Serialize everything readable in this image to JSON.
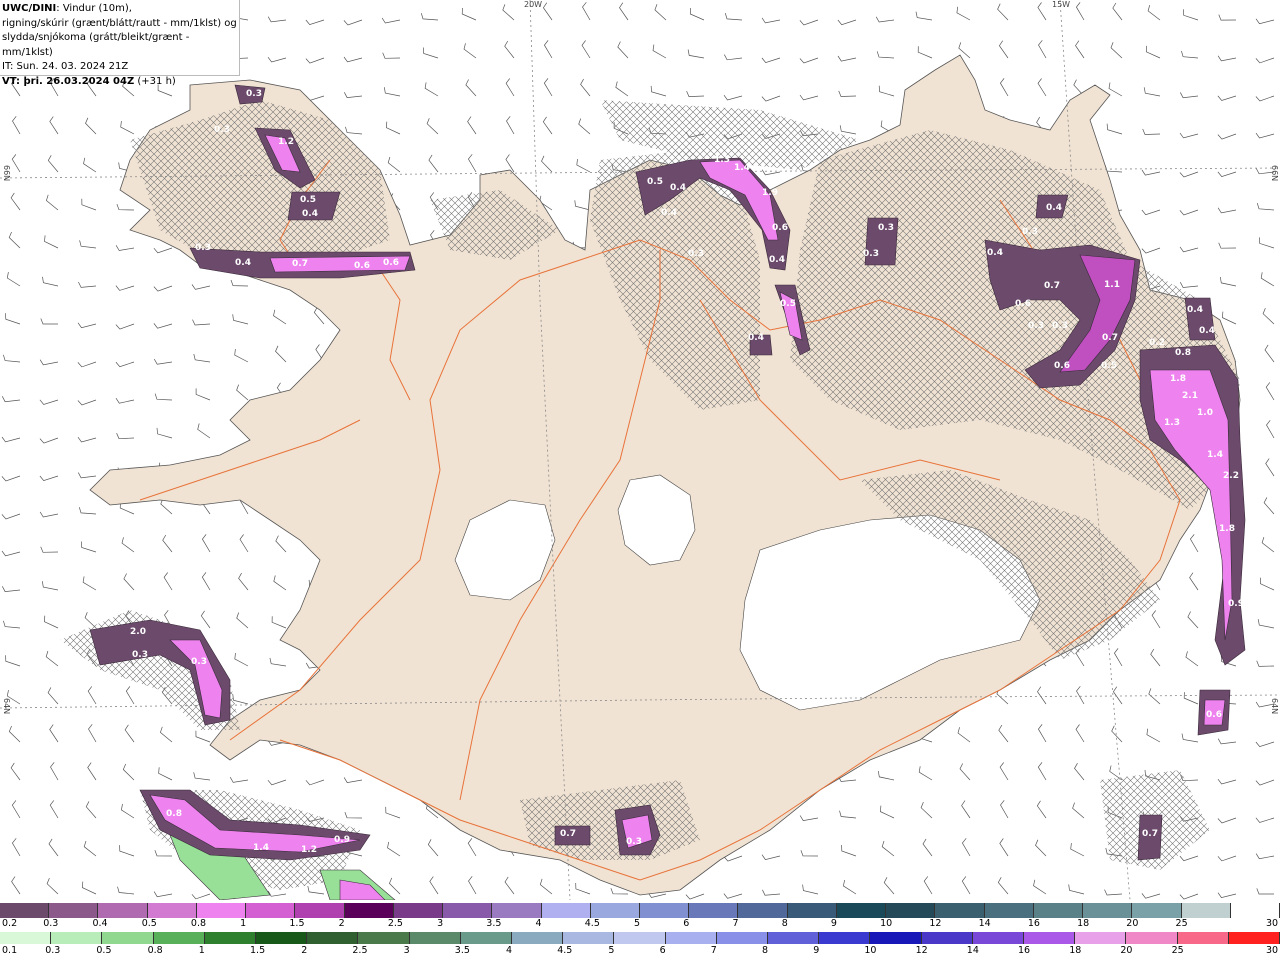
{
  "header": {
    "model": "UWC/DINI",
    "line1_rest": ": Vindur (10m),",
    "line2": "rigning/skúrir (grænt/blátt/rautt - mm/1klst) og",
    "line3": "slydda/snjókoma (grátt/bleikt/grænt - mm/1klst)",
    "it": "IT: Sun. 24. 03. 2024 21Z",
    "vt_label": "VT: þri. 26.03.2024 04Z",
    "vt_offset": "(+31 h)"
  },
  "grid_labels": {
    "lon_20w": "20W",
    "lon_15w": "15W",
    "lat_66n_left": "66N",
    "lat_66n_right": "66N",
    "lat_64n_left": "64N",
    "lat_64n_right": "64N"
  },
  "colors": {
    "land": "#f1e3d3",
    "glacier": "#ffffff",
    "roads": "#e8733a",
    "wind_barbs": "#555555",
    "snow_dark": "#6b4a6b",
    "snow_mid": "#c04fc0",
    "snow_bright": "#ee82ee",
    "rain_green": "#98e098"
  },
  "precip_values": [
    "0.3",
    "0.3",
    "1.2",
    "0.5",
    "0.4",
    "0.3",
    "0.4",
    "0.7",
    "0.6",
    "0.6",
    "0.5",
    "0.4",
    "1.3",
    "1.4",
    "1.9",
    "0.6",
    "0.4",
    "0.5",
    "0.4",
    "0.4",
    "0.3",
    "0.3",
    "0.3",
    "0.4",
    "0.3",
    "0.4",
    "0.7",
    "0.6",
    "0.3",
    "0.3",
    "1.1",
    "0.7",
    "0.6",
    "0.5",
    "0.2",
    "0.4",
    "0.4",
    "0.8",
    "1.8",
    "2.1",
    "1.0",
    "1.3",
    "1.4",
    "2.2",
    "1.8",
    "0.9",
    "2.0",
    "0.3",
    "0.3",
    "0.8",
    "1.4",
    "1.2",
    "0.9",
    "0.7",
    "0.3",
    "0.7",
    "0.6"
  ],
  "legend_snow": {
    "ticks": [
      "0.2",
      "0.3",
      "0.4",
      "0.5",
      "0.8",
      "1",
      "1.5",
      "2",
      "2.5",
      "3",
      "3.5",
      "4",
      "4.5",
      "5",
      "6",
      "7",
      "8",
      "9",
      "10",
      "12",
      "14",
      "16",
      "18",
      "20",
      "25",
      "30"
    ],
    "colors": [
      "#6b4a6b",
      "#8b5a8b",
      "#b06bb0",
      "#d27ad2",
      "#ee82ee",
      "#d35fd3",
      "#b03fb0",
      "#5a005a",
      "#7a3a8a",
      "#8a5aaa",
      "#9a7ac0",
      "#b0b0f0",
      "#9aa8e0",
      "#8090d0",
      "#6878b8",
      "#50689a",
      "#3a5a7a",
      "#1a4a5a",
      "#244a5a",
      "#3a6070",
      "#4a7080",
      "#5a8088",
      "#6a9098",
      "#7aa0a8",
      "#c0d0d0",
      "#ffffff"
    ]
  },
  "legend_rain": {
    "ticks": [
      "0.1",
      "0.3",
      "0.5",
      "0.8",
      "1",
      "1.5",
      "2",
      "2.5",
      "3",
      "3.5",
      "4",
      "4.5",
      "5",
      "6",
      "7",
      "8",
      "9",
      "10",
      "12",
      "14",
      "16",
      "18",
      "20",
      "25",
      "30"
    ],
    "colors": [
      "#d8f8d8",
      "#b8ecb8",
      "#90d890",
      "#58b058",
      "#2e802e",
      "#185818",
      "#306030",
      "#4a7a4a",
      "#5a8a6a",
      "#6a9a8a",
      "#8aaac0",
      "#a8b8e0",
      "#c0c8f0",
      "#a8b0f0",
      "#8890e8",
      "#6060d8",
      "#3a3ad0",
      "#1818b8",
      "#4a38c8",
      "#7a48d8",
      "#aa58e8",
      "#e8a0e8",
      "#f088c8",
      "#f86888",
      "#ff2020"
    ]
  }
}
